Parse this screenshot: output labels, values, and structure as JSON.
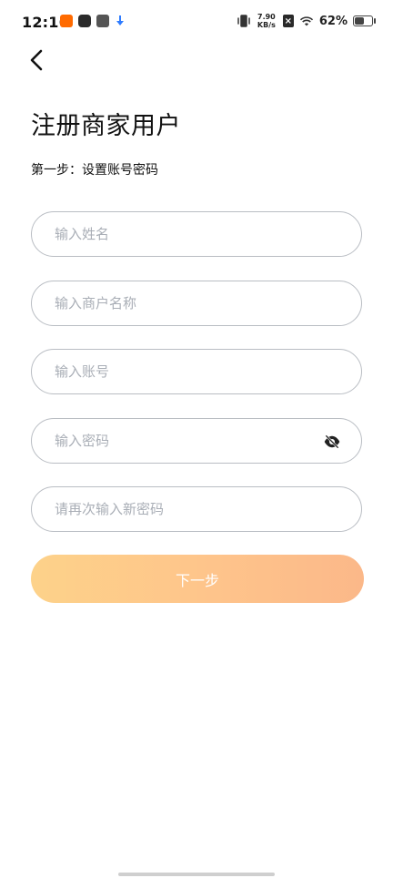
{
  "status_bar": {
    "time": "12:16",
    "net_speed_value": "7.90",
    "net_speed_unit": "KB/s",
    "battery_percent": "62%"
  },
  "header": {
    "title": "注册商家用户",
    "step": "第一步：设置账号密码"
  },
  "form": {
    "name_placeholder": "输入姓名",
    "merchant_placeholder": "输入商户名称",
    "account_placeholder": "输入账号",
    "password_placeholder": "输入密码",
    "confirm_placeholder": "请再次输入新密码"
  },
  "actions": {
    "next_label": "下一步"
  },
  "icons": {
    "back": "back-arrow-icon",
    "eye": "eye-off-icon"
  },
  "colors": {
    "button_gradient_start": "#fdd28a",
    "button_gradient_end": "#fbb889",
    "field_border": "#b9bdc3",
    "placeholder": "#a9aeb6"
  }
}
